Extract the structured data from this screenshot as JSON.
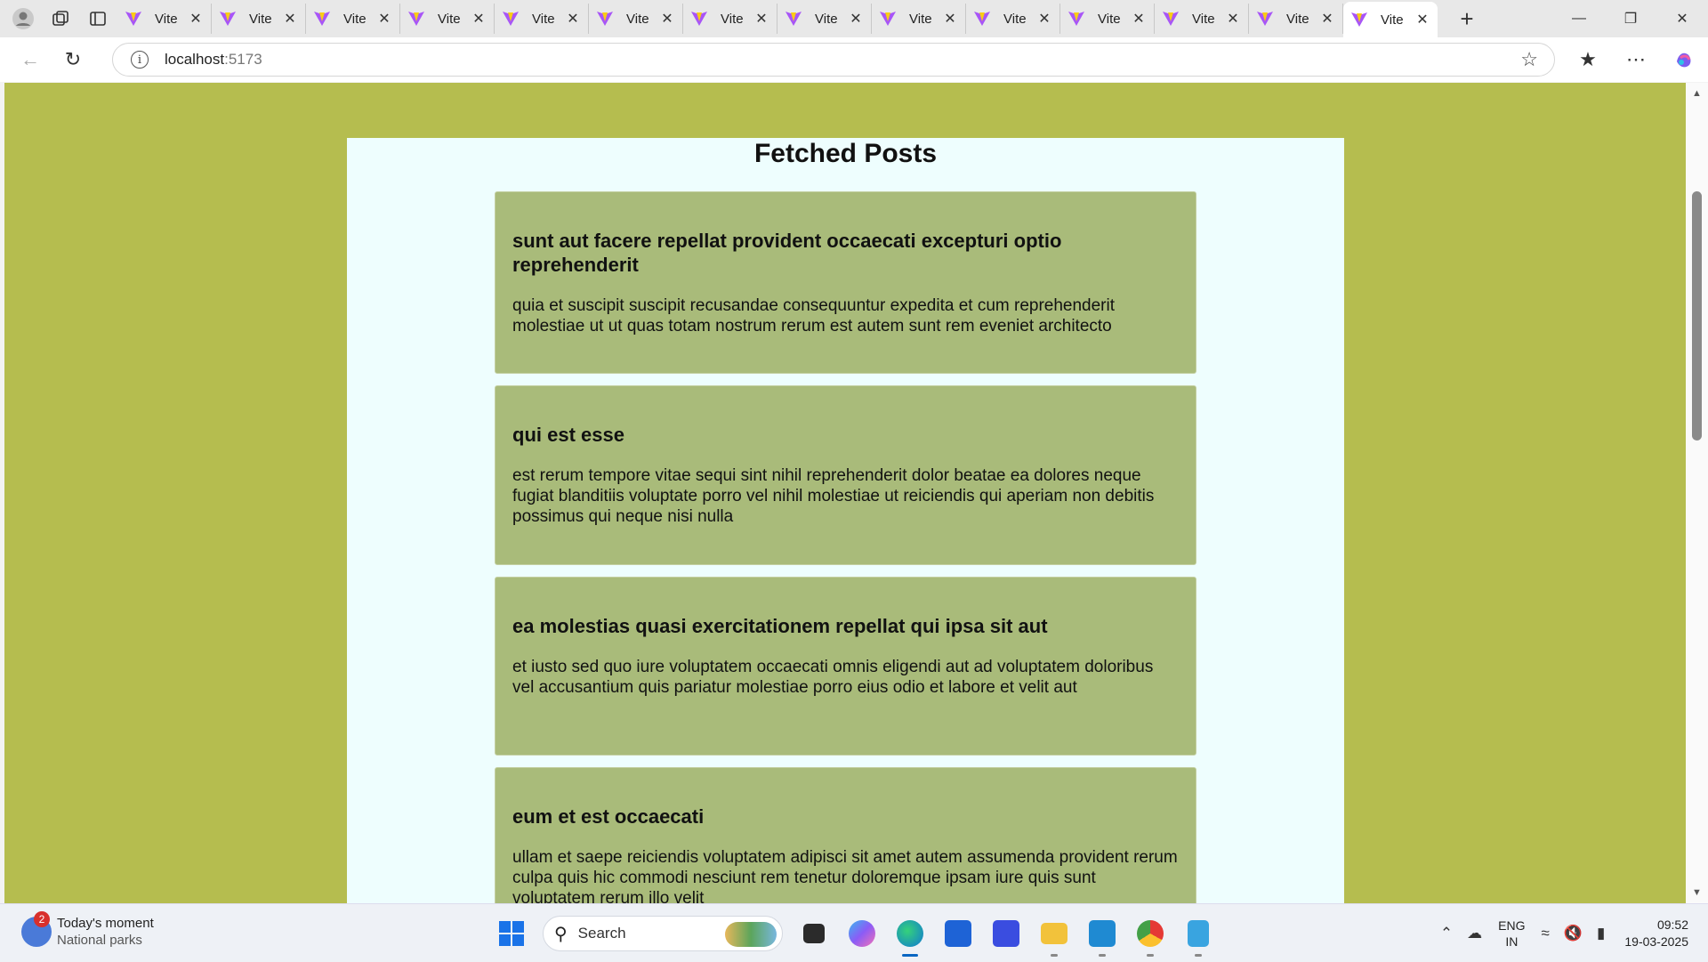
{
  "browser": {
    "tabs": [
      {
        "label": "Vite",
        "active": false
      },
      {
        "label": "Vite",
        "active": false
      },
      {
        "label": "Vite",
        "active": false
      },
      {
        "label": "Vite",
        "active": false
      },
      {
        "label": "Vite",
        "active": false
      },
      {
        "label": "Vite",
        "active": false
      },
      {
        "label": "Vite",
        "active": false
      },
      {
        "label": "Vite",
        "active": false
      },
      {
        "label": "Vite",
        "active": false
      },
      {
        "label": "Vite",
        "active": false
      },
      {
        "label": "Vite",
        "active": false
      },
      {
        "label": "Vite",
        "active": false
      },
      {
        "label": "Vite",
        "active": false
      },
      {
        "label": "Vite",
        "active": true
      }
    ],
    "url_host": "localhost",
    "url_port": ":5173"
  },
  "page": {
    "title": "Fetched Posts",
    "posts": [
      {
        "title": "sunt aut facere repellat provident occaecati excepturi optio reprehenderit",
        "body": "quia et suscipit suscipit recusandae consequuntur expedita et cum reprehenderit molestiae ut ut quas totam nostrum rerum est autem sunt rem eveniet architecto"
      },
      {
        "title": "qui est esse",
        "body": "est rerum tempore vitae sequi sint nihil reprehenderit dolor beatae ea dolores neque fugiat blanditiis voluptate porro vel nihil molestiae ut reiciendis qui aperiam non debitis possimus qui neque nisi nulla"
      },
      {
        "title": "ea molestias quasi exercitationem repellat qui ipsa sit aut",
        "body": "et iusto sed quo iure voluptatem occaecati omnis eligendi aut ad voluptatem doloribus vel accusantium quis pariatur molestiae porro eius odio et labore et velit aut"
      },
      {
        "title": "eum et est occaecati",
        "body": "ullam et saepe reiciendis voluptatem adipisci sit amet autem assumenda provident rerum culpa quis hic commodi nesciunt rem tenetur doloremque ipsam iure quis sunt voluptatem rerum illo velit"
      }
    ]
  },
  "taskbar": {
    "weather_badge": "2",
    "weather_title": "Today's moment",
    "weather_sub": "National parks",
    "search_label": "Search",
    "lang_top": "ENG",
    "lang_bottom": "IN",
    "time": "09:52",
    "date": "19-03-2025"
  },
  "colors": {
    "page_background": "#b5bd4f",
    "container_background": "#eefefe",
    "post_background": "#a9bb7a"
  }
}
